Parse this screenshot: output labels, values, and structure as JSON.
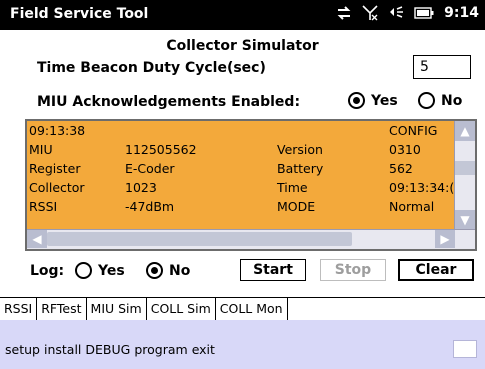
{
  "titlebar": {
    "title": "Field Service Tool",
    "time": "9:14"
  },
  "collector_title": "Collector Simulator",
  "duty_cycle": {
    "label": "Time Beacon Duty Cycle(sec)",
    "value": "5"
  },
  "ack": {
    "label": "MIU Acknowledgements Enabled:",
    "yes": "Yes",
    "no": "No",
    "selected": "Yes"
  },
  "log": {
    "rows": [
      [
        "09:13:38",
        "",
        "",
        "CONFIG"
      ],
      [
        "MIU",
        "112505562",
        "Version",
        "0310"
      ],
      [
        "Register",
        "E-Coder",
        "Battery",
        "562"
      ],
      [
        "Collector",
        "1023",
        "Time",
        "09:13:34:("
      ],
      [
        "RSSI",
        "-47dBm",
        "MODE",
        "Normal"
      ]
    ]
  },
  "log_toggle": {
    "label": "Log:",
    "yes": "Yes",
    "no": "No",
    "selected": "No"
  },
  "buttons": {
    "start": "Start",
    "stop": "Stop",
    "clear": "Clear"
  },
  "tabs": [
    "RSSI",
    "RFTest",
    "MIU Sim",
    "COLL Sim",
    "COLL Mon"
  ],
  "active_tab": "COLL Sim",
  "menu": [
    "setup",
    "install",
    "DEBUG",
    "program",
    "exit"
  ],
  "colors": {
    "log_background": "#f3a93b",
    "menubar": "#d8d8f8"
  }
}
